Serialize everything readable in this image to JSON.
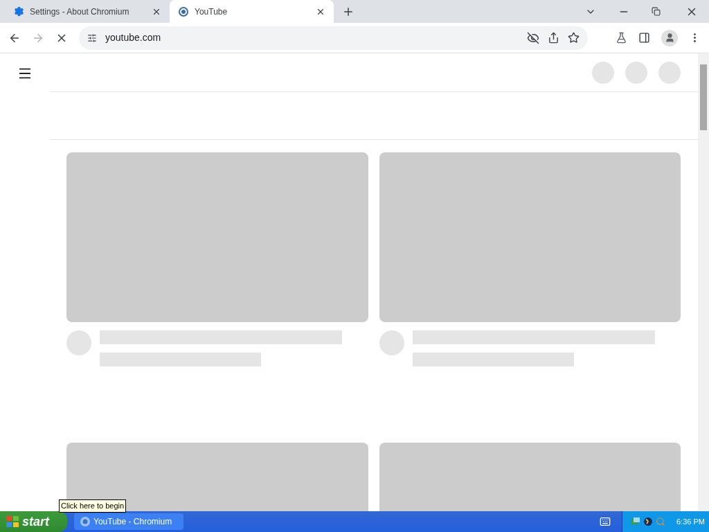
{
  "tabs": [
    {
      "title": "Settings - About Chromium",
      "kind": "settings",
      "selected": false
    },
    {
      "title": "YouTube",
      "kind": "youtube",
      "selected": true
    }
  ],
  "toolbar": {
    "url": "youtube.com",
    "loading": true
  },
  "page": {
    "header_circles": [
      {
        "kind": "placeholder"
      },
      {
        "kind": "placeholder"
      },
      {
        "kind": "placeholder"
      }
    ],
    "cards": [
      {
        "kind": "video"
      },
      {
        "kind": "video"
      },
      {
        "kind": "thumbnail_only"
      },
      {
        "kind": "thumbnail_only"
      }
    ]
  },
  "taskbar": {
    "start": "start",
    "tooltip": "Click here to begin",
    "tasks": [
      {
        "title": "YouTube - Chromium",
        "selected": false
      }
    ],
    "clock": "6:36 PM"
  }
}
